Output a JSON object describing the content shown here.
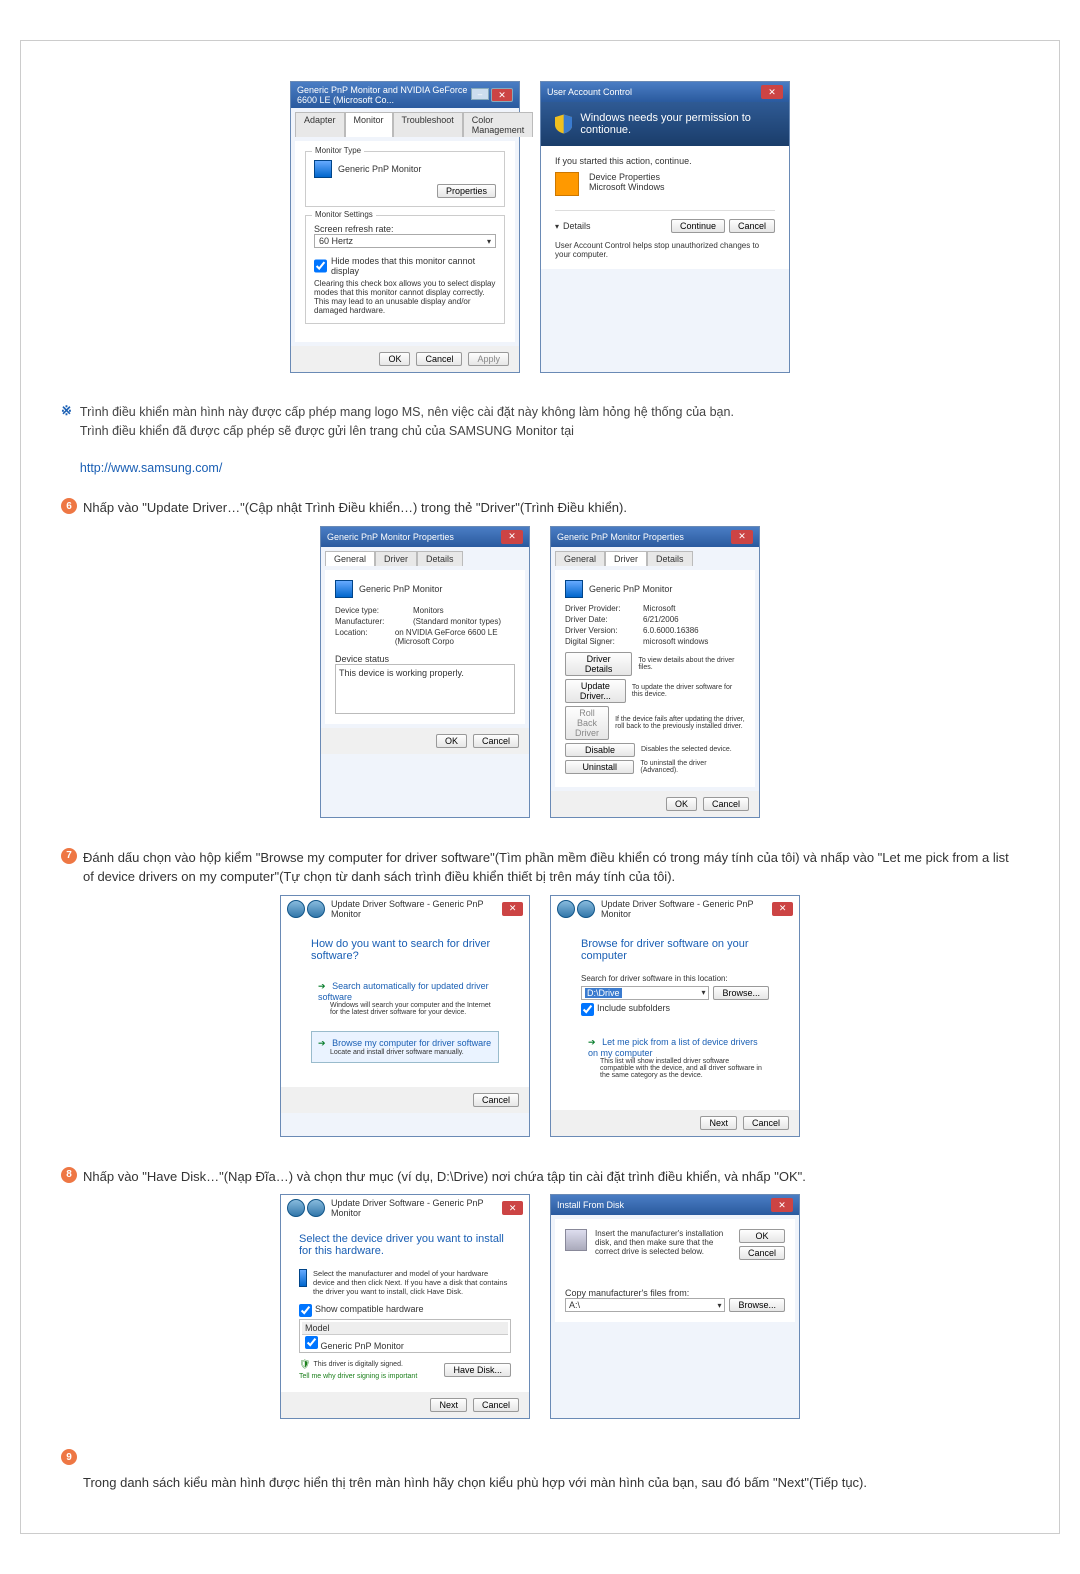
{
  "dialog1": {
    "title": "Generic PnP Monitor and NVIDIA GeForce 6600 LE (Microsoft Co...",
    "tab_adapter": "Adapter",
    "tab_monitor": "Monitor",
    "tab_troubleshoot": "Troubleshoot",
    "tab_color": "Color Management",
    "monitor_type_label": "Monitor Type",
    "monitor_type_value": "Generic PnP Monitor",
    "properties_btn": "Properties",
    "monitor_settings_label": "Monitor Settings",
    "refresh_label": "Screen refresh rate:",
    "refresh_value": "60 Hertz",
    "hide_modes_label": "Hide modes that this monitor cannot display",
    "hide_modes_desc": "Clearing this check box allows you to select display modes that this monitor cannot display correctly. This may lead to an unusable display and/or damaged hardware.",
    "ok": "OK",
    "cancel": "Cancel",
    "apply": "Apply"
  },
  "uac": {
    "title": "User Account Control",
    "heading": "Windows needs your permission to contionue.",
    "started_line": "If you started this action, continue.",
    "devprops": "Device Properties",
    "mswin": "Microsoft Windows",
    "details": "Details",
    "continue": "Continue",
    "cancel": "Cancel",
    "footer": "User Account Control helps stop unauthorized changes to your computer."
  },
  "note1": {
    "line1": "Trình điều khiển màn hình này được cấp phép mang logo MS, nên việc cài đặt này không làm hỏng hệ thống của bạn.",
    "line2": "Trình điều khiển đã được cấp phép sẽ được gửi lên trang chủ của SAMSUNG Monitor tại",
    "url": "http://www.samsung.com/"
  },
  "step6_text": "Nhấp vào \"Update Driver…\"(Cập nhật Trình Điều khiển…) trong thẻ \"Driver\"(Trình Điều khiển).",
  "props_general": {
    "title": "Generic PnP Monitor Properties",
    "tab_general": "General",
    "tab_driver": "Driver",
    "tab_details": "Details",
    "device_name": "Generic PnP Monitor",
    "devtype_label": "Device type:",
    "devtype_value": "Monitors",
    "mfr_label": "Manufacturer:",
    "mfr_value": "(Standard monitor types)",
    "loc_label": "Location:",
    "loc_value": "on NVIDIA GeForce 6600 LE (Microsoft Corpo",
    "devstatus_label": "Device status",
    "devstatus_value": "This device is working properly.",
    "ok": "OK",
    "cancel": "Cancel"
  },
  "props_driver": {
    "title": "Generic PnP Monitor Properties",
    "provider_label": "Driver Provider:",
    "provider_value": "Microsoft",
    "date_label": "Driver Date:",
    "date_value": "6/21/2006",
    "version_label": "Driver Version:",
    "version_value": "6.0.6000.16386",
    "signer_label": "Digital Signer:",
    "signer_value": "microsoft windows",
    "btn_details": "Driver Details",
    "btn_details_desc": "To view details about the driver files.",
    "btn_update": "Update Driver...",
    "btn_update_desc": "To update the driver software for this device.",
    "btn_rollback": "Roll Back Driver",
    "btn_rollback_desc": "If the device fails after updating the driver, roll back to the previously installed driver.",
    "btn_disable": "Disable",
    "btn_disable_desc": "Disables the selected device.",
    "btn_uninstall": "Uninstall",
    "btn_uninstall_desc": "To uninstall the driver (Advanced).",
    "ok": "OK",
    "cancel": "Cancel"
  },
  "step7_text": "Đánh dấu chọn vào hộp kiểm \"Browse my computer for driver software\"(Tìm phần mềm điều khiển có trong máy tính của tôi) và nhấp vào \"Let me pick from a list of device drivers on my computer\"(Tự chọn từ danh sách trình điều khiển thiết bị trên máy tính của tôi).",
  "wiz1": {
    "breadcrumb": "Update Driver Software - Generic PnP Monitor",
    "heading": "How do you want to search for driver software?",
    "opt1_title": "Search automatically for updated driver software",
    "opt1_desc": "Windows will search your computer and the Internet for the latest driver software for your device.",
    "opt2_title": "Browse my computer for driver software",
    "opt2_desc": "Locate and install driver software manually.",
    "cancel": "Cancel"
  },
  "wiz2": {
    "breadcrumb": "Update Driver Software - Generic PnP Monitor",
    "heading": "Browse for driver software on your computer",
    "search_label": "Search for driver software in this location:",
    "path_value": "D:\\Drive",
    "browse": "Browse...",
    "include_sub": "Include subfolders",
    "opt_title": "Let me pick from a list of device drivers on my computer",
    "opt_desc": "This list will show installed driver software compatible with the device, and all driver software in the same category as the device.",
    "next": "Next",
    "cancel": "Cancel"
  },
  "step8_text": "Nhấp vào \"Have Disk…\"(Nạp Đĩa…) và chọn thư mục (ví dụ, D:\\Drive) nơi chứa tập tin cài đặt trình điều khiển, và nhấp \"OK\".",
  "wiz3": {
    "breadcrumb": "Update Driver Software - Generic PnP Monitor",
    "heading": "Select the device driver you want to install for this hardware.",
    "note": "Select the manufacturer and model of your hardware device and then click Next. If you have a disk that contains the driver you want to install, click Have Disk.",
    "show_compat": "Show compatible hardware",
    "model_header": "Model",
    "model_item": "Generic PnP Monitor",
    "signed_note": "This driver is digitally signed.",
    "tell_me": "Tell me why driver signing is important",
    "have_disk": "Have Disk...",
    "next": "Next",
    "cancel": "Cancel"
  },
  "install_disk": {
    "title": "Install From Disk",
    "msg": "Insert the manufacturer's installation disk, and then make sure that the correct drive is selected below.",
    "ok": "OK",
    "cancel": "Cancel",
    "copy_label": "Copy manufacturer's files from:",
    "path": "A:\\",
    "browse": "Browse..."
  },
  "step9_text": "Trong danh sách kiểu màn hình được hiển thị trên màn hình hãy chọn kiểu phù hợp với màn hình của bạn, sau đó bấm \"Next\"(Tiếp tục)."
}
